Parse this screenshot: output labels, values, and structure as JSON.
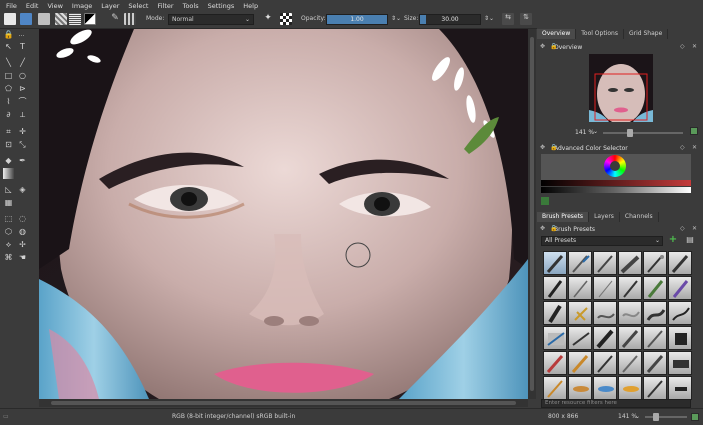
{
  "menu": [
    "File",
    "Edit",
    "View",
    "Image",
    "Layer",
    "Select",
    "Filter",
    "Tools",
    "Settings",
    "Help"
  ],
  "toolbar": {
    "mode_label": "Mode:",
    "mode_value": "Normal",
    "opacity_label": "Opacity:",
    "opacity_value": "1.00",
    "opacity_fraction": 1.0,
    "size_label": "Size:",
    "size_value": "30.00",
    "size_fraction": 0.1
  },
  "docker": {
    "top_tabs": [
      "Overview",
      "Tool Options",
      "Grid Shape"
    ],
    "overview_title": "Overview",
    "overview_zoom": "141 %",
    "color_selector_title": "Advanced Color Selector",
    "mid_tabs": [
      "Brush Presets",
      "Layers",
      "Channels"
    ],
    "brush_presets_title": "Brush Presets",
    "preset_filter": "All Presets",
    "tag_search_placeholder": "Enter resource filters here"
  },
  "status": {
    "color_profile": "RGB (8-bit integer/channel)  sRGB built-in",
    "image_size": "800 x 866",
    "zoom": "141 %"
  },
  "colors": {
    "accent": "#4a7fb0",
    "panel_bg": "#3b3b3b",
    "lips": "#e0608e"
  }
}
